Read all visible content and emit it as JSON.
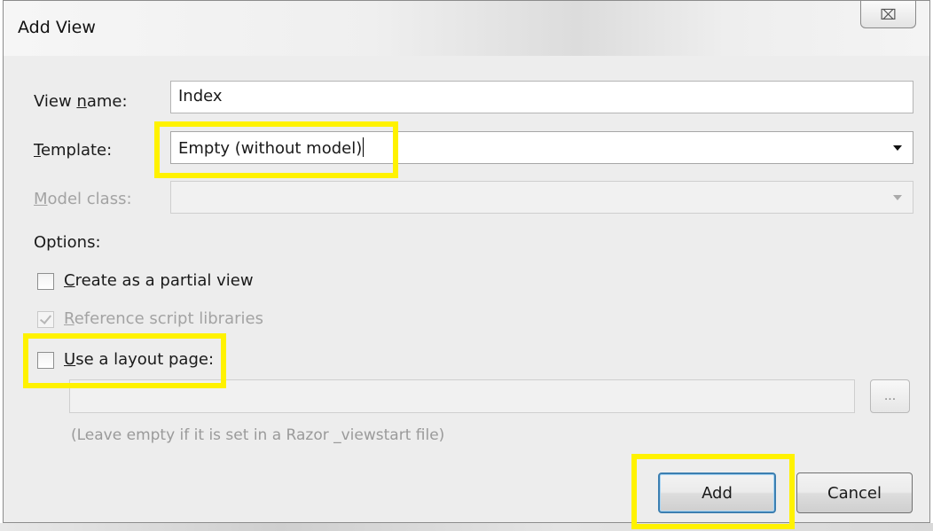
{
  "dialog": {
    "title": "Add View",
    "close_glyph": "⌧"
  },
  "form": {
    "view_name": {
      "label_pre": "View ",
      "label_accel": "n",
      "label_post": "ame:",
      "value": "Index"
    },
    "template": {
      "label_accel": "T",
      "label_post": "emplate:",
      "value": "Empty (without model)"
    },
    "model_class": {
      "label_accel": "M",
      "label_post": "odel class:",
      "value": ""
    },
    "options_label": "Options:",
    "partial_view": {
      "accel": "C",
      "rest": "reate as a partial view",
      "checked": false
    },
    "reference_scripts": {
      "accel": "R",
      "rest": "eference script libraries",
      "checked": true,
      "enabled": false
    },
    "layout_page": {
      "accel": "U",
      "rest": "se a layout page:",
      "checked": false
    },
    "layout_path": {
      "value": "",
      "browse_label": "..."
    },
    "hint": "(Leave empty if it is set in a Razor _viewstart file)"
  },
  "buttons": {
    "add": "Add",
    "cancel": "Cancel"
  },
  "colors": {
    "highlight": "#fff200",
    "default_button_border": "#3c7fb1",
    "dialog_background": "#ededed"
  }
}
